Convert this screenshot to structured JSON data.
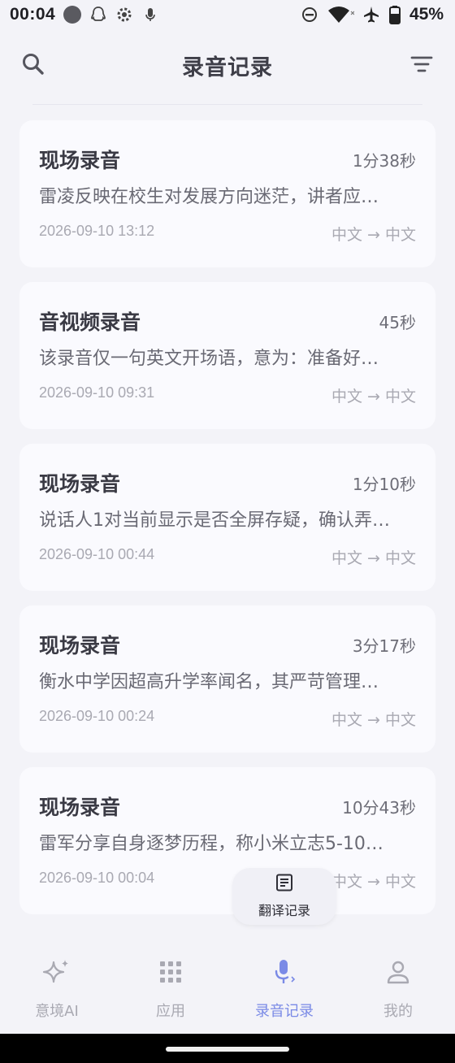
{
  "status_bar": {
    "time": "00:04",
    "battery_percent": "45%",
    "icons": [
      "circle-notification-icon",
      "qq-icon",
      "gear-icon",
      "mic-icon",
      "dnd-icon",
      "wifi-icon",
      "airplane-icon",
      "battery-icon"
    ]
  },
  "header": {
    "title": "录音记录",
    "left_icon": "search-icon",
    "right_icon": "filter-icon"
  },
  "records": [
    {
      "title": "现场录音",
      "duration": "1分38秒",
      "summary": "雷凌反映在校生对发展方向迷茫，讲者应…",
      "date": "2026-09-10 13:12",
      "lang": "中文 → 中文"
    },
    {
      "title": "音视频录音",
      "duration": "45秒",
      "summary": "该录音仅一句英文开场语，意为：准备好…",
      "date": "2026-09-10 09:31",
      "lang": "中文 → 中文"
    },
    {
      "title": "现场录音",
      "duration": "1分10秒",
      "summary": "说话人1对当前显示是否全屏存疑，确认弄…",
      "date": "2026-09-10 00:44",
      "lang": "中文 → 中文"
    },
    {
      "title": "现场录音",
      "duration": "3分17秒",
      "summary": "衡水中学因超高升学率闻名，其严苛管理…",
      "date": "2026-09-10 00:24",
      "lang": "中文 → 中文"
    },
    {
      "title": "现场录音",
      "duration": "10分43秒",
      "summary": "雷军分享自身逐梦历程，称小米立志5-10…",
      "date": "2026-09-10 00:04",
      "lang": "中文 → 中文"
    }
  ],
  "float_button": {
    "label": "翻译记录",
    "icon": "document-icon"
  },
  "bottom_nav": {
    "items": [
      {
        "label": "意境AI",
        "icon": "sparkle-icon",
        "active": false
      },
      {
        "label": "应用",
        "icon": "grid-icon",
        "active": false
      },
      {
        "label": "录音记录",
        "icon": "mic-icon",
        "active": true
      },
      {
        "label": "我的",
        "icon": "person-icon",
        "active": false
      }
    ]
  },
  "colors": {
    "accent": "#7a8ae6",
    "background": "#f3f3f8",
    "card": "#fafafe"
  }
}
